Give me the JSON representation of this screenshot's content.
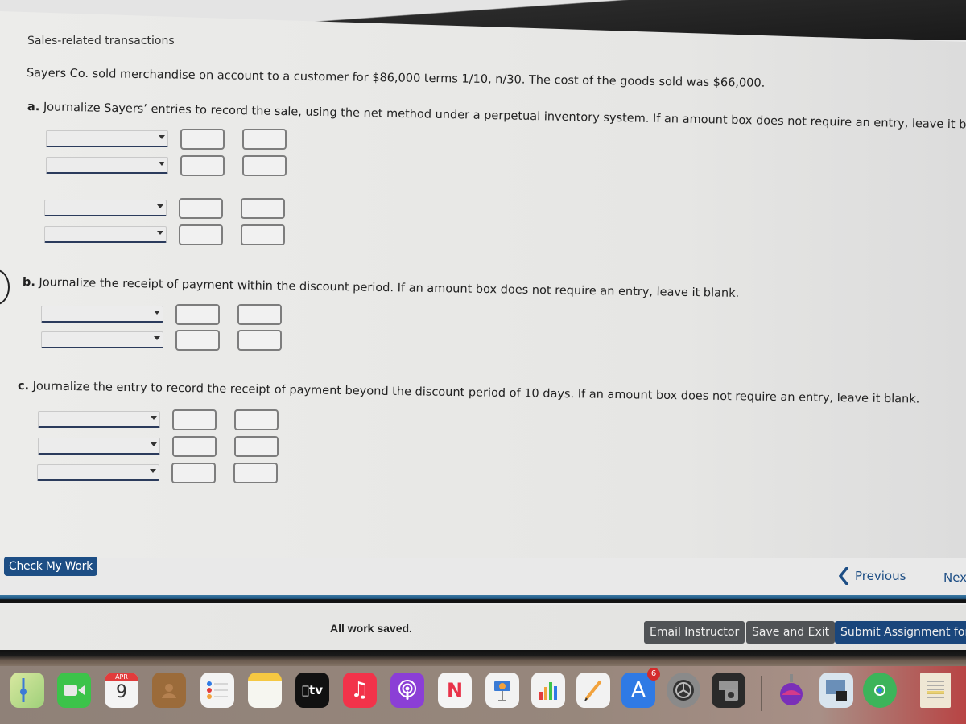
{
  "page": {
    "title": "Sales-related transactions",
    "problem": "Sayers Co. sold merchandise on account to a customer for $86,000 terms 1/10, n/30. The cost of the goods sold was $66,000."
  },
  "questions": [
    {
      "letter": "a.",
      "text": " Journalize Sayers’ entries to record the sale, using the net method under a perpetual inventory system. If an amount box does not require an entry, leave it bla",
      "entries": [
        {
          "rows": [
            {
              "account": "",
              "debit": "",
              "credit": ""
            },
            {
              "account": "",
              "debit": "",
              "credit": ""
            }
          ]
        },
        {
          "rows": [
            {
              "account": "",
              "debit": "",
              "credit": ""
            },
            {
              "account": "",
              "debit": "",
              "credit": ""
            }
          ]
        }
      ]
    },
    {
      "letter": "b.",
      "text": " Journalize the receipt of payment within the discount period. If an amount box does not require an entry, leave it blank.",
      "entries": [
        {
          "rows": [
            {
              "account": "",
              "debit": "",
              "credit": ""
            },
            {
              "account": "",
              "debit": "",
              "credit": ""
            }
          ]
        }
      ]
    },
    {
      "letter": "c.",
      "text": " Journalize the entry to record the receipt of payment beyond the discount period of 10 days. If an amount box does not require an entry, leave it blank.",
      "entries": [
        {
          "rows": [
            {
              "account": "",
              "debit": "",
              "credit": ""
            },
            {
              "account": "",
              "debit": "",
              "credit": ""
            },
            {
              "account": "",
              "debit": "",
              "credit": ""
            }
          ]
        }
      ]
    }
  ],
  "actions": {
    "check_my_work": "Check My Work",
    "previous": "Previous",
    "next": "Next"
  },
  "footer": {
    "status": "All work saved.",
    "email_instructor": "Email Instructor",
    "save_and_exit": "Save and Exit",
    "submit": "Submit Assignment for Grading"
  },
  "dock": {
    "items": [
      {
        "name": "maps",
        "label": ""
      },
      {
        "name": "facetime",
        "label": ""
      },
      {
        "name": "calendar",
        "month": "APR",
        "day": "9"
      },
      {
        "name": "contacts",
        "label": ""
      },
      {
        "name": "reminders",
        "label": ""
      },
      {
        "name": "notes",
        "label": ""
      },
      {
        "name": "apple-tv",
        "label": "tv"
      },
      {
        "name": "music",
        "label": "♫"
      },
      {
        "name": "podcasts",
        "label": ""
      },
      {
        "name": "news",
        "label": "N"
      },
      {
        "name": "keynote",
        "label": ""
      },
      {
        "name": "numbers",
        "label": ""
      },
      {
        "name": "pages",
        "label": ""
      },
      {
        "name": "app-store",
        "label": "A",
        "badge": "6"
      },
      {
        "name": "system-preferences",
        "label": ""
      },
      {
        "name": "screenshot",
        "label": ""
      },
      {
        "name": "macos-installer",
        "label": ""
      },
      {
        "name": "preview",
        "label": ""
      },
      {
        "name": "find-my",
        "label": ""
      },
      {
        "name": "document",
        "label": ""
      }
    ]
  },
  "colors": {
    "primary_button": "#1d4e85",
    "secondary_button": "#505356",
    "link": "#1d4e85",
    "badge": "#d42b2b"
  }
}
